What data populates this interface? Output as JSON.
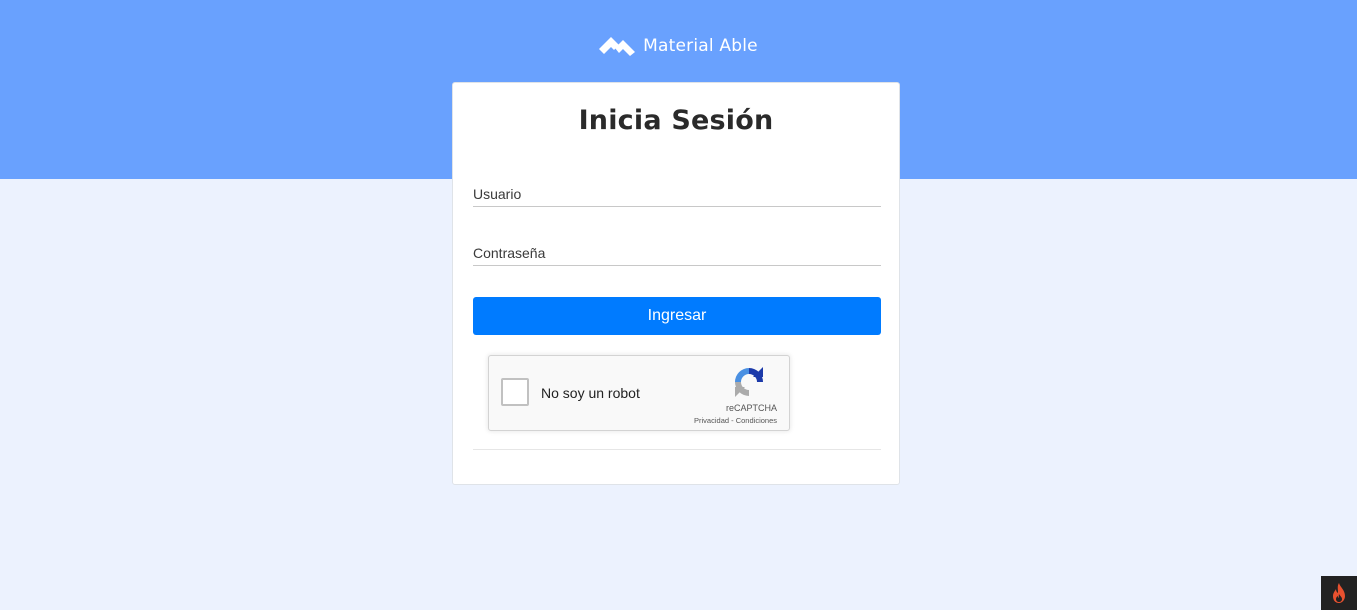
{
  "brand": {
    "name": "Material Able",
    "logo_icon": "chevron-mountain-logo-icon"
  },
  "colors": {
    "header_band": "#69a1fe",
    "page_background": "#ecf2fe",
    "primary_button": "#007bff",
    "corner_badge_background": "#222222",
    "corner_flame": "#e8512f"
  },
  "login": {
    "title": "Inicia Sesión",
    "username_placeholder": "Usuario",
    "username_value": "",
    "password_placeholder": "Contraseña",
    "password_value": "",
    "submit_label": "Ingresar"
  },
  "captcha": {
    "label": "No soy un robot",
    "brand": "reCAPTCHA",
    "privacy_link": "Privacidad",
    "separator": " - ",
    "terms_link": "Condiciones",
    "checked": false,
    "logo_icon": "recaptcha-icon"
  },
  "corner_badge": {
    "icon": "flame-icon"
  }
}
